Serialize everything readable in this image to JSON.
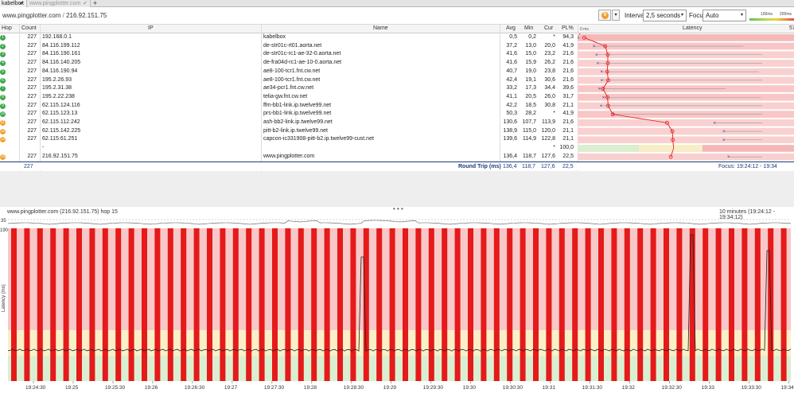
{
  "tabs": [
    {
      "label": "kabelbox",
      "close": "✔",
      "active": true
    },
    {
      "label": "www.pingplotter.com",
      "close": "✔",
      "active": false
    }
  ],
  "new_tab": "+",
  "target": {
    "host": "www.pingplotter.com",
    "sep": "/",
    "ip": "216.92.151.75"
  },
  "controls": {
    "interval_label": "Interval",
    "interval_value": "2,5 seconds",
    "focus_label": "Focus",
    "focus_value": "Auto",
    "scale_left": "100ms",
    "scale_right": "200ms"
  },
  "table": {
    "columns": {
      "hop": "Hop",
      "count": "Count",
      "ip": "IP",
      "name": "Name",
      "avg": "Avg",
      "min": "Min",
      "cur": "Cur",
      "pl": "PL%",
      "latency": "Latency"
    },
    "latency_scale_start": "0 ms",
    "latency_scale_end": "57",
    "rows": [
      {
        "hop": "1",
        "count": "227",
        "ip": "192.168.0.1",
        "name": "kabelbox",
        "avg": "0,5",
        "min": "0,2",
        "cur": "*",
        "pl": "94,3",
        "dot": "#3aa64a"
      },
      {
        "hop": "2",
        "count": "227",
        "ip": "84.116.199.112",
        "name": "de-str01c-rt01.aorta.net",
        "avg": "37,2",
        "min": "13,0",
        "cur": "20,0",
        "pl": "41,9",
        "dot": "#3aa64a"
      },
      {
        "hop": "3",
        "count": "227",
        "ip": "84.116.190.161",
        "name": "de-str01c-rc1-ae-32-0.aorta.net",
        "avg": "41,6",
        "min": "15,0",
        "cur": "23,2",
        "pl": "21,6",
        "dot": "#3aa64a"
      },
      {
        "hop": "4",
        "count": "227",
        "ip": "84.116.140.205",
        "name": "de-fra04d-rc1-ae-10-0.aorta.net",
        "avg": "41,6",
        "min": "15,9",
        "cur": "26,2",
        "pl": "21,6",
        "dot": "#3aa64a"
      },
      {
        "hop": "5",
        "count": "227",
        "ip": "84.116.190.94",
        "name": "ae8-100-tcr1.fnt.cw.net",
        "avg": "40,7",
        "min": "19,0",
        "cur": "23,8",
        "pl": "21,6",
        "dot": "#3aa64a"
      },
      {
        "hop": "6",
        "count": "227",
        "ip": "195.2.26.93",
        "name": "ae8-100-tcr1.fnt.cw.net",
        "avg": "42,4",
        "min": "19,1",
        "cur": "30,6",
        "pl": "21,6",
        "dot": "#3aa64a"
      },
      {
        "hop": "7",
        "count": "227",
        "ip": "195.2.31.38",
        "name": "ae34-pcr1.fnt.cw.net",
        "avg": "33,2",
        "min": "17,3",
        "cur": "34,4",
        "pl": "39,6",
        "dot": "#3aa64a"
      },
      {
        "hop": "8",
        "count": "227",
        "ip": "195.2.22.238",
        "name": "telia-gw.fnt.cw.net",
        "avg": "41,1",
        "min": "20,5",
        "cur": "26,0",
        "pl": "31,7",
        "dot": "#3aa64a"
      },
      {
        "hop": "9",
        "count": "227",
        "ip": "62.115.124.116",
        "name": "ffm-bb1-link.ip.twelve99.net",
        "avg": "42,2",
        "min": "18,5",
        "cur": "30,8",
        "pl": "21,1",
        "dot": "#3aa64a"
      },
      {
        "hop": "10",
        "count": "227",
        "ip": "62.115.123.13",
        "name": "prs-bb1-link.ip.twelve99.net",
        "avg": "50,3",
        "min": "28,2",
        "cur": "*",
        "pl": "41,9",
        "dot": "#3aa64a"
      },
      {
        "hop": "11",
        "count": "227",
        "ip": "62.115.112.242",
        "name": "ash-bb2-link.ip.twelve99.net",
        "avg": "130,6",
        "min": "107,7",
        "cur": "113,9",
        "pl": "21,6",
        "dot": "#f0a028"
      },
      {
        "hop": "12",
        "count": "227",
        "ip": "62.115.142.225",
        "name": "pitt-b2-link.ip.twelve99.net",
        "avg": "138,9",
        "min": "115,0",
        "cur": "120,0",
        "pl": "21,1",
        "dot": "#f0a028"
      },
      {
        "hop": "13",
        "count": "227",
        "ip": "62.115.61.251",
        "name": "capcon-ic331908-pitt-b2.ip.twelve99-cust.net",
        "avg": "139,6",
        "min": "114,9",
        "cur": "122,8",
        "pl": "21,1",
        "dot": "#f0a028"
      },
      {
        "hop": "",
        "count": "",
        "ip": "-",
        "name": "",
        "avg": "",
        "min": "",
        "cur": "*",
        "pl": "100,0",
        "dot": ""
      },
      {
        "hop": "15",
        "count": "227",
        "ip": "216.92.151.75",
        "name": "www.pingplotter.com",
        "avg": "136,4",
        "min": "118,7",
        "cur": "127,6",
        "pl": "22,5",
        "dot": "#f0a028"
      }
    ],
    "summary": {
      "count": "227",
      "label": "Round Trip (ms)",
      "avg": "136,4",
      "min": "118,7",
      "cur": "127,6",
      "pl": "22,5",
      "focus": "Focus: 19:24:12 - 19:34"
    }
  },
  "timeline": {
    "title": "www.pingplotter.com (216.92.151.75) hop 15",
    "range": "10 minutes (19:24:12 - 19:34:12)",
    "ylabel": "Latency (ms)",
    "top_value": "35",
    "ytick": "190",
    "xticks": [
      "19:24:30",
      "19:25",
      "19:25:30",
      "19:26",
      "19:26:30",
      "19:27",
      "19:27:30",
      "19:28",
      "19:28:30",
      "19:29",
      "19:29:30",
      "19:30",
      "19:30:30",
      "19:31",
      "19:31:30",
      "19:32",
      "19:32:30",
      "19:33",
      "19:33:30",
      "19:34"
    ]
  },
  "splitter_label": "• • •",
  "colors": {
    "accent_red": "#e51a1a",
    "zone_red": "#f8c8c8",
    "zone_yellow": "#faf0c8",
    "zone_green": "#daefd2",
    "dark_blue": "#1a3a7a"
  }
}
